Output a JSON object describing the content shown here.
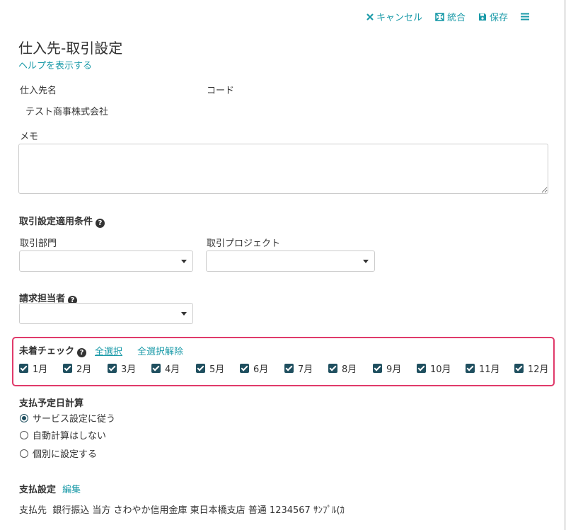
{
  "toolbar": {
    "cancel_label": "キャンセル",
    "merge_label": "統合",
    "save_label": "保存"
  },
  "page": {
    "title": "仕入先-取引設定",
    "help_link": "ヘルプを表示する"
  },
  "supplier": {
    "name_label": "仕入先名",
    "name_value": "テスト商事株式会社",
    "code_label": "コード"
  },
  "memo": {
    "label": "メモ",
    "value": ""
  },
  "conditions": {
    "heading": "取引設定適用条件",
    "department_label": "取引部門",
    "department_value": "",
    "project_label": "取引プロジェクト",
    "project_value": ""
  },
  "billing": {
    "label": "請求担当者",
    "value": ""
  },
  "unarrived_check": {
    "label": "未着チェック",
    "select_all": "全選択",
    "deselect_all": "全選択解除",
    "months": [
      {
        "label": "1月",
        "checked": true
      },
      {
        "label": "2月",
        "checked": true
      },
      {
        "label": "3月",
        "checked": true
      },
      {
        "label": "4月",
        "checked": true
      },
      {
        "label": "5月",
        "checked": true
      },
      {
        "label": "6月",
        "checked": true
      },
      {
        "label": "7月",
        "checked": true
      },
      {
        "label": "8月",
        "checked": true
      },
      {
        "label": "9月",
        "checked": true
      },
      {
        "label": "10月",
        "checked": true
      },
      {
        "label": "11月",
        "checked": true
      },
      {
        "label": "12月",
        "checked": true
      }
    ]
  },
  "payment_calc": {
    "heading": "支払予定日計算",
    "options": [
      {
        "label": "サービス設定に従う",
        "selected": true
      },
      {
        "label": "自動計算はしない",
        "selected": false
      },
      {
        "label": "個別に設定する",
        "selected": false
      }
    ]
  },
  "payment_settings": {
    "heading": "支払設定",
    "edit_link": "編集",
    "detail": "支払先  銀行振込 当方 さわやか信用金庫 東日本橋支店 普通 1234567 ｻﾝﾌﾟﾙ(ｶ"
  },
  "colors": {
    "accent": "#1a9aa8",
    "highlight_border": "#e03a6a",
    "checkbox": "#1f4f5f"
  }
}
